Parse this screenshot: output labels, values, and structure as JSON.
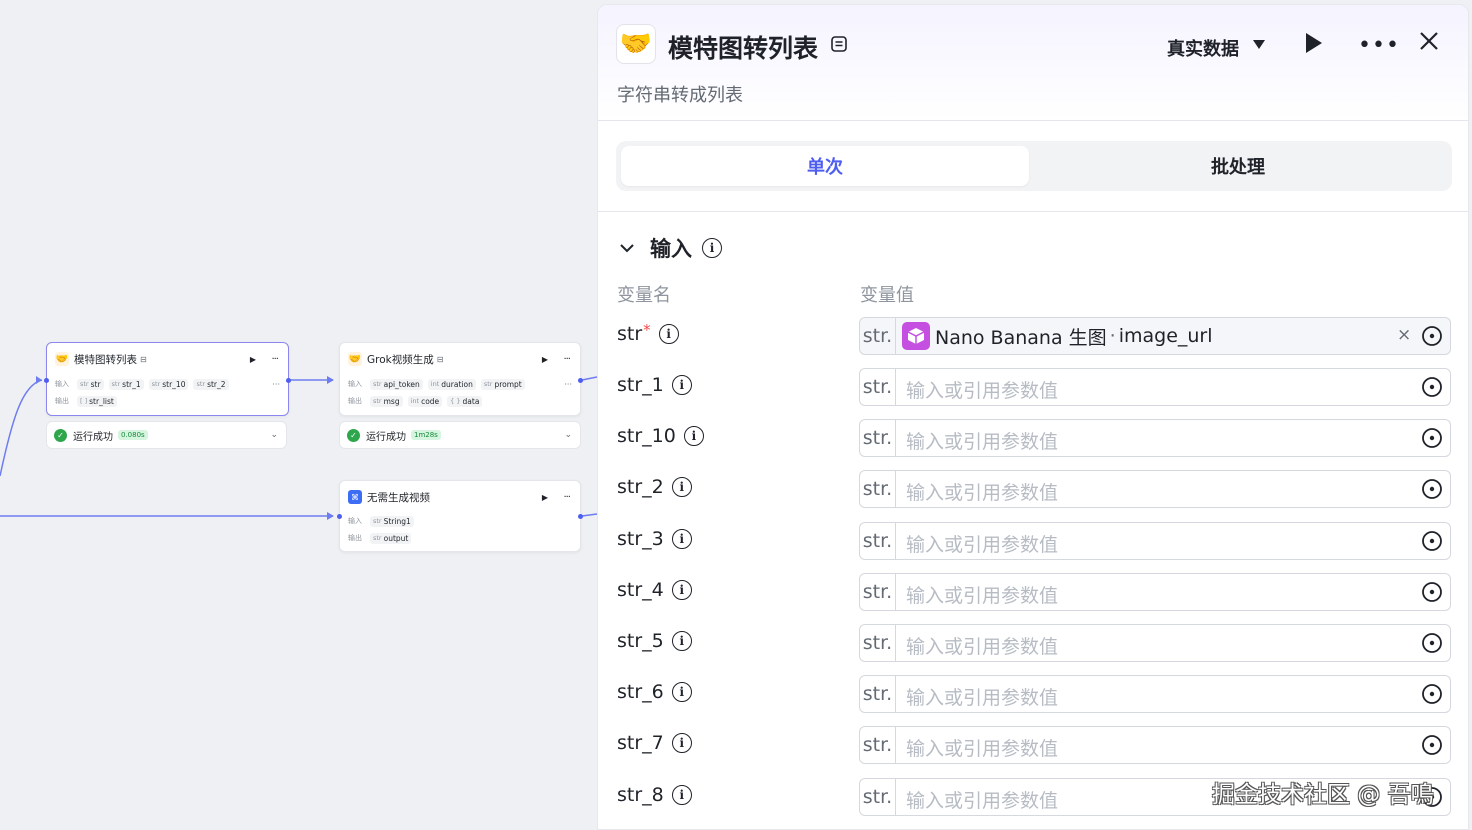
{
  "canvas": {
    "node_model": {
      "title": "模特图转列表",
      "input_label": "输入",
      "output_label": "输出",
      "inputs": [
        {
          "type": "str",
          "name": "str"
        },
        {
          "type": "str",
          "name": "str_1"
        },
        {
          "type": "str",
          "name": "str_10"
        },
        {
          "type": "str",
          "name": "str_2"
        }
      ],
      "more_inputs": "···",
      "outputs": [
        {
          "type": "[ ]",
          "name": "str_list"
        }
      ],
      "status": "运行成功",
      "time": "0.080s"
    },
    "node_grok": {
      "title": "Grok视频生成",
      "input_label": "输入",
      "output_label": "输出",
      "inputs": [
        {
          "type": "str",
          "name": "api_token"
        },
        {
          "type": "int",
          "name": "duration"
        },
        {
          "type": "str",
          "name": "prompt"
        }
      ],
      "more_inputs": "···",
      "outputs": [
        {
          "type": "str",
          "name": "msg"
        },
        {
          "type": "int",
          "name": "code"
        },
        {
          "type": "{ }",
          "name": "data"
        }
      ],
      "status": "运行成功",
      "time": "1m28s"
    },
    "node_novideo": {
      "title": "无需生成视频",
      "input_label": "输入",
      "output_label": "输出",
      "inputs": [
        {
          "type": "str",
          "name": "String1"
        }
      ],
      "outputs": [
        {
          "type": "str",
          "name": "output"
        }
      ]
    }
  },
  "panel": {
    "title": "模特图转列表",
    "description": "字符串转成列表",
    "data_mode": "真实数据",
    "tabs": [
      "单次",
      "批处理"
    ],
    "section_title": "输入",
    "col_name": "变量名",
    "col_value": "变量值",
    "type_label": "str.",
    "placeholder": "输入或引用参数值",
    "ref": {
      "source": "Nano Banana 生图",
      "dot": "·",
      "field": "image_url",
      "clear": "×"
    },
    "vars": [
      {
        "name": "str",
        "required": "*"
      },
      {
        "name": "str_1"
      },
      {
        "name": "str_10"
      },
      {
        "name": "str_2"
      },
      {
        "name": "str_3"
      },
      {
        "name": "str_4"
      },
      {
        "name": "str_5"
      },
      {
        "name": "str_6"
      },
      {
        "name": "str_7"
      },
      {
        "name": "str_8"
      }
    ]
  },
  "watermark": "掘金技术社区 @ 吾鳴",
  "colors": {
    "accent": "#4e5ef0",
    "success": "#2ea64c",
    "edge": "#6e7cf0",
    "selected_border": "#8b86f0"
  }
}
